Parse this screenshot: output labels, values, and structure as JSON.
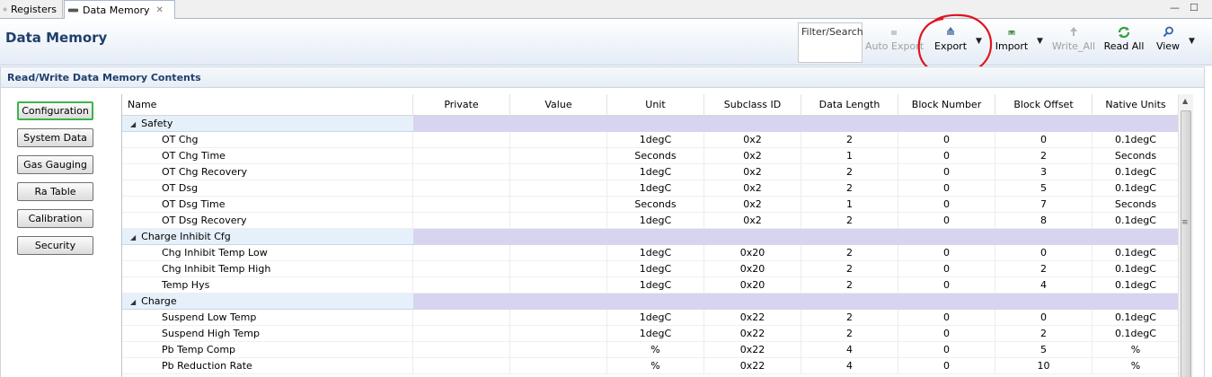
{
  "tabs": [
    {
      "label": "Registers",
      "icon": "gear-icon",
      "active": false
    },
    {
      "label": "Data Memory",
      "icon": "memory-chip-icon",
      "active": true
    }
  ],
  "window_controls": {
    "minimize": "—",
    "maximize": "☐"
  },
  "header": {
    "title": "Data Memory"
  },
  "toolbar": {
    "filter_label": "Filter/Search",
    "auto_export": "Auto Export",
    "export": "Export",
    "import": "Import",
    "write_all": "Write_All",
    "read_all": "Read All",
    "view": "View"
  },
  "section": {
    "title": "Read/Write Data Memory Contents"
  },
  "sidebar": {
    "items": [
      {
        "label": "Configuration",
        "active": true
      },
      {
        "label": "System Data",
        "active": false
      },
      {
        "label": "Gas Gauging",
        "active": false
      },
      {
        "label": "Ra Table",
        "active": false
      },
      {
        "label": "Calibration",
        "active": false
      },
      {
        "label": "Security",
        "active": false
      }
    ]
  },
  "table": {
    "columns": [
      "Name",
      "Private",
      "Value",
      "Unit",
      "Subclass ID",
      "Data Length",
      "Block Number",
      "Block Offset",
      "Native Units"
    ],
    "groups": [
      {
        "name": "Safety",
        "rows": [
          [
            "OT Chg",
            "",
            "",
            "1degC",
            "0x2",
            "2",
            "0",
            "0",
            "0.1degC"
          ],
          [
            "OT Chg Time",
            "",
            "",
            "Seconds",
            "0x2",
            "1",
            "0",
            "2",
            "Seconds"
          ],
          [
            "OT Chg Recovery",
            "",
            "",
            "1degC",
            "0x2",
            "2",
            "0",
            "3",
            "0.1degC"
          ],
          [
            "OT Dsg",
            "",
            "",
            "1degC",
            "0x2",
            "2",
            "0",
            "5",
            "0.1degC"
          ],
          [
            "OT Dsg Time",
            "",
            "",
            "Seconds",
            "0x2",
            "1",
            "0",
            "7",
            "Seconds"
          ],
          [
            "OT Dsg Recovery",
            "",
            "",
            "1degC",
            "0x2",
            "2",
            "0",
            "8",
            "0.1degC"
          ]
        ]
      },
      {
        "name": "Charge Inhibit Cfg",
        "rows": [
          [
            "Chg Inhibit Temp Low",
            "",
            "",
            "1degC",
            "0x20",
            "2",
            "0",
            "0",
            "0.1degC"
          ],
          [
            "Chg Inhibit Temp High",
            "",
            "",
            "1degC",
            "0x20",
            "2",
            "0",
            "2",
            "0.1degC"
          ],
          [
            "Temp Hys",
            "",
            "",
            "1degC",
            "0x20",
            "2",
            "0",
            "4",
            "0.1degC"
          ]
        ]
      },
      {
        "name": "Charge",
        "rows": [
          [
            "Suspend Low Temp",
            "",
            "",
            "1degC",
            "0x22",
            "2",
            "0",
            "0",
            "0.1degC"
          ],
          [
            "Suspend High Temp",
            "",
            "",
            "1degC",
            "0x22",
            "2",
            "0",
            "2",
            "0.1degC"
          ],
          [
            "Pb Temp Comp",
            "",
            "",
            "%",
            "0x22",
            "4",
            "0",
            "5",
            "%"
          ],
          [
            "Pb Reduction Rate",
            "",
            "",
            "%",
            "0x22",
            "4",
            "0",
            "10",
            "%"
          ]
        ]
      }
    ]
  },
  "colors": {
    "title": "#1f3f6b",
    "group_row": "#d7d4ef",
    "annotation": "#e0141e",
    "active_border": "#3bb54a"
  }
}
